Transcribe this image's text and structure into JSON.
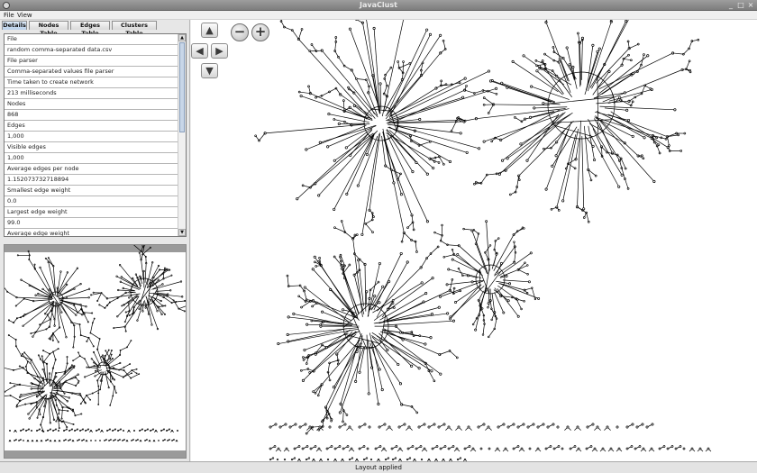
{
  "window": {
    "title": "JavaClust"
  },
  "menu": {
    "file": "File",
    "view": "View"
  },
  "tabs": [
    "Details",
    "Nodes Table",
    "Edges Table",
    "Clusters Table"
  ],
  "details": [
    {
      "label": "File",
      "value": "random comma-separated data.csv"
    },
    {
      "label": "File parser",
      "value": "Comma-separated values file parser"
    },
    {
      "label": "Time taken to create network",
      "value": "213 milliseconds"
    },
    {
      "label": "Nodes",
      "value": "868"
    },
    {
      "label": "Edges",
      "value": "1,000"
    },
    {
      "label": "Visible edges",
      "value": "1,000"
    },
    {
      "label": "Average edges per node",
      "value": "1.152073732718894"
    },
    {
      "label": "Smallest edge weight",
      "value": "0.0"
    },
    {
      "label": "Largest edge weight",
      "value": "99.0"
    },
    {
      "label": "Average edge weight",
      "value": ""
    }
  ],
  "status": {
    "text": "Layout applied"
  },
  "icons": {
    "pan_up": "arrow-up-icon",
    "pan_down": "arrow-down-icon",
    "pan_left": "arrow-left-icon",
    "pan_right": "arrow-right-icon",
    "zoom_out": "minus-icon",
    "zoom_in": "plus-icon"
  }
}
